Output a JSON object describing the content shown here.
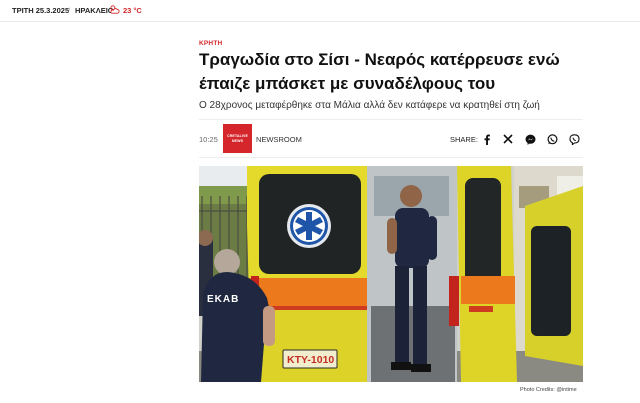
{
  "topbar": {
    "date": "ΤΡΙΤΗ 25.3.2025",
    "separator": "/",
    "city": "ΗΡΑΚΛΕΙΟ",
    "weather_icon": "cloud-sun-icon",
    "temperature": "23 °C"
  },
  "article": {
    "category": "ΚΡΗΤΗ",
    "headline_line1": "Τραγωδία στο Σίσι - Νεαρός κατέρρευσε ενώ",
    "headline_line2": "έπαιζε μπάσκετ με συναδέλφους του",
    "subtitle": "Ο 28χρονος μεταφέρθηκε στα Μάλια αλλά δεν κατάφερε να κρατηθεί στη ζωή",
    "time": "10:25",
    "source_logo_line1": "CRETALIVE",
    "source_logo_line2": "NEWS",
    "source": "NEWSROOM",
    "share_label": "SHARE:",
    "share_icons": [
      "facebook-icon",
      "x-icon",
      "messenger-icon",
      "whatsapp-icon",
      "viber-icon"
    ]
  },
  "photo": {
    "vehicle_label": "EKAB",
    "plate": "ΚΤΥ-1010",
    "credit": "Photo Credits: @intime"
  },
  "colors": {
    "accent": "#d4262b",
    "ambulance_yellow": "#e5dc2a",
    "ambulance_orange": "#ec7a1c",
    "uniform_navy": "#1f2840"
  }
}
